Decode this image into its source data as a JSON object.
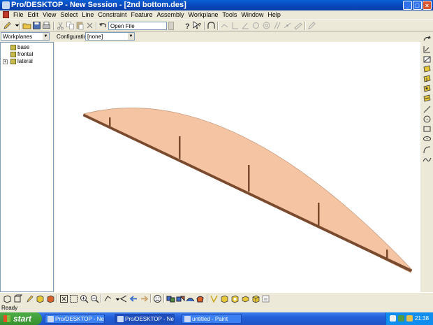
{
  "window": {
    "title": "Pro/DESKTOP - New Session - [2nd bottom.des]",
    "controls": [
      "_",
      "□",
      "×"
    ]
  },
  "menubar": {
    "items": [
      "File",
      "Edit",
      "View",
      "Select",
      "Line",
      "Constraint",
      "Feature",
      "Assembly",
      "Workplane",
      "Tools",
      "Window",
      "Help"
    ]
  },
  "toolbar": {
    "open_file_label": "Open File"
  },
  "left_panel": {
    "selector_value": "Workplanes",
    "tree": [
      {
        "label": "base",
        "expandable": false
      },
      {
        "label": "frontal",
        "expandable": false
      },
      {
        "label": "lateral",
        "expandable": true
      }
    ]
  },
  "configuration": {
    "label": "Configuration:",
    "value": "[none]"
  },
  "model": {
    "fill_color": "#f5c4a3",
    "edge_color": "#7a4a2e"
  },
  "status": {
    "text": "Ready"
  },
  "taskbar": {
    "start_label": "start",
    "tasks": [
      {
        "label": "Pro/DESKTOP - New ...",
        "active": false
      },
      {
        "label": "Pro/DESKTOP - New ...",
        "active": true
      },
      {
        "label": "untitled - Paint",
        "active": false
      }
    ],
    "clock": "21:38"
  },
  "icons": {
    "right_toolbar": [
      "rotate-icon",
      "dimension-icon",
      "sketch-icon",
      "workplane-yellow-icon",
      "workplane-select-icon",
      "workplane-edit-icon",
      "workplane-new-icon",
      "line-icon",
      "circle-icon",
      "rectangle-icon",
      "ellipse-icon",
      "arc-icon",
      "spline-icon"
    ],
    "bottom_toolbar": [
      "view-iso-icon",
      "view-front-icon",
      "view-edit-icon",
      "shaded-icon",
      "render-icon",
      "zoom-fit-icon",
      "zoom-window-icon",
      "zoom-in-icon",
      "zoom-out-icon",
      "pan-icon",
      "previous-view-icon",
      "back-icon",
      "forward-icon",
      "face-icon",
      "design-icon",
      "assembly-icon",
      "component-icon",
      "material-icon",
      "feature-icon",
      "box-icon",
      "shape-icon",
      "sheet-icon",
      "cube-icon",
      "refresh-icon"
    ]
  }
}
